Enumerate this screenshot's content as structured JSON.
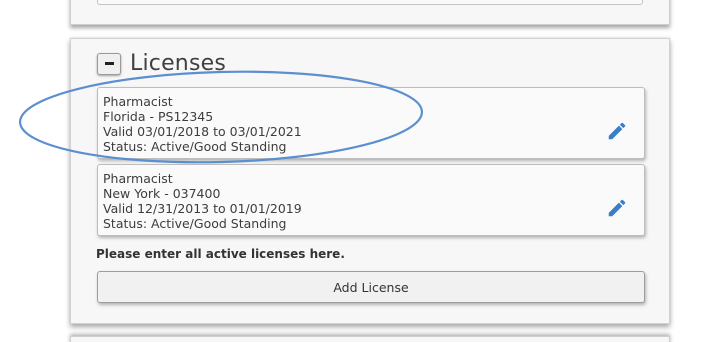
{
  "section": {
    "title": "Licenses",
    "collapse_symbol": "−"
  },
  "licenses": [
    {
      "type": "Pharmacist",
      "state_number": "Florida - PS12345",
      "valid": "Valid 03/01/2018 to 03/01/2021",
      "status": "Status: Active/Good Standing",
      "edit_icon": "pencil-icon"
    },
    {
      "type": "Pharmacist",
      "state_number": "New York - 037400",
      "valid": "Valid 12/31/2013 to 01/01/2019",
      "status": "Status: Active/Good Standing",
      "edit_icon": "pencil-icon"
    }
  ],
  "note": "Please enter all active licenses here.",
  "add_button_label": "Add License",
  "colors": {
    "edit_icon": "#3a7dc8",
    "annotation_ellipse": "#5b8fd0"
  }
}
